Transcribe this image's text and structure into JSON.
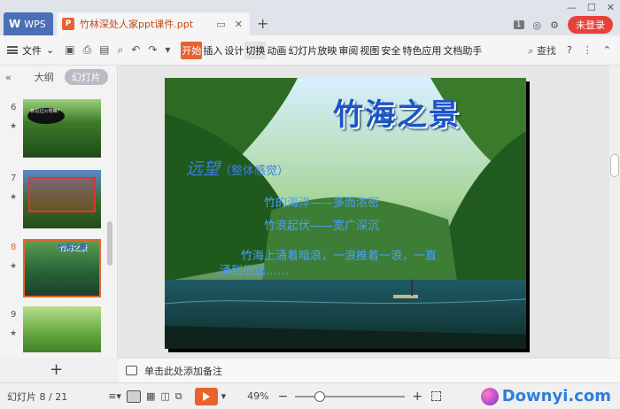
{
  "titlebar": {
    "wps_tab": "WPS",
    "doc_tab": "竹林深处人家ppt课件.ppt",
    "new_tab": "+",
    "badge_num": "1",
    "login": "未登录"
  },
  "ribbon": {
    "file": "文件",
    "menu": [
      "开始",
      "插入",
      "设计",
      "切换",
      "动画",
      "幻灯片放映",
      "审阅",
      "视图",
      "安全",
      "特色应用",
      "文档助手"
    ],
    "search": "查找",
    "help": "?"
  },
  "left_panel": {
    "outline_tab": "大纲",
    "slides_tab": "幻灯片",
    "slides": [
      {
        "number": "6",
        "caption": "你见过火地嘛？"
      },
      {
        "number": "7",
        "caption": ""
      },
      {
        "number": "8",
        "caption": "竹海之景",
        "selected": true
      },
      {
        "number": "9",
        "caption": ""
      }
    ]
  },
  "slide": {
    "title": "竹海之景",
    "subtitle": "远望",
    "subtitle_note": "（整体感觉）",
    "line1": "竹的海洋——多而浓密",
    "line2": "竹浪起伏——宽广深沉",
    "line3": "竹海上涌着暗浪，一浪推着一浪，一直",
    "line4": "涌到很远……"
  },
  "notes": {
    "placeholder": "单击此处添加备注"
  },
  "status": {
    "slide_count": "幻灯片 8 / 21",
    "zoom": "49%",
    "zoom_fraction": 0.22,
    "watermark": "Downyi.com"
  },
  "colors": {
    "accent": "#e8622d",
    "title_blue": "#1a55c8",
    "text_blue": "#4aa0ff"
  }
}
